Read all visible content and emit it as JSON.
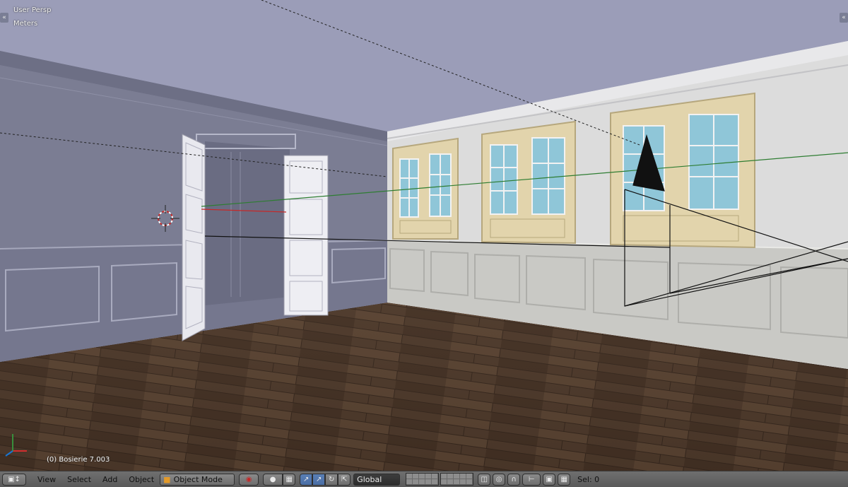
{
  "viewport": {
    "view_name": "User Persp",
    "units": "Meters",
    "active_object": "(0) Bosierie 7.003",
    "left_toggle": "«",
    "right_toggle": "«"
  },
  "header": {
    "editor_type_icon": "cube-icon",
    "menus": [
      "View",
      "Select",
      "Add",
      "Object"
    ],
    "mode": "Object Mode",
    "mode_icon": "orange-cube-icon",
    "pivot_icon": "pivot-icon",
    "shading_icon": "shading-sphere-icon",
    "transform_orientation": "Global",
    "status": "Sel: 0"
  },
  "colors": {
    "sky": "#9a9cb6",
    "header_bg": "#666666",
    "accent": "#5a7fb5"
  }
}
